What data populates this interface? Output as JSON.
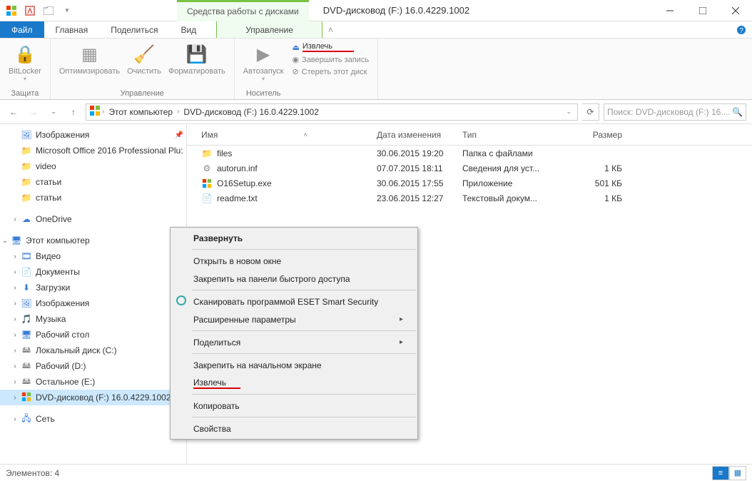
{
  "title": "DVD-дисковод (F:) 16.0.4229.1002",
  "contextual_tab_label": "Средства работы с дисками",
  "tabs": {
    "file": "Файл",
    "home": "Главная",
    "share": "Поделиться",
    "view": "Вид",
    "manage": "Управление"
  },
  "ribbon": {
    "group1_label": "Защита",
    "bitlocker": "BitLocker",
    "group2_label": "Управление",
    "optimize": "Оптимизировать",
    "cleanup": "Очистить",
    "format": "Форматировать",
    "group3_label": "Носитель",
    "autorun": "Автозапуск",
    "eject": "Извлечь",
    "finalize": "Завершить запись",
    "erase": "Стереть этот диск"
  },
  "breadcrumb": {
    "this_pc": "Этот компьютер",
    "dvd": "DVD-дисковод (F:) 16.0.4229.1002"
  },
  "search_placeholder": "Поиск: DVD-дисковод (F:) 16....",
  "sidebar": {
    "pictures": "Изображения",
    "office": "Microsoft Office 2016 Professional Plu:",
    "video": "video",
    "articles1": "статьи",
    "articles2": "статьи",
    "onedrive": "OneDrive",
    "this_pc": "Этот компьютер",
    "videos": "Видео",
    "documents": "Документы",
    "downloads": "Загрузки",
    "pictures2": "Изображения",
    "music": "Музыка",
    "desktop": "Рабочий стол",
    "local_c": "Локальный диск (C:)",
    "local_d": "Рабочий (D:)",
    "local_e": "Остальное (E:)",
    "dvd_f": "DVD-дисковод (F:) 16.0.4229.1002",
    "network": "Сеть"
  },
  "columns": {
    "name": "Имя",
    "date": "Дата изменения",
    "type": "Тип",
    "size": "Размер"
  },
  "files": [
    {
      "name": "files",
      "date": "30.06.2015 19:20",
      "type": "Папка с файлами",
      "size": "",
      "icon": "folder"
    },
    {
      "name": "autorun.inf",
      "date": "07.07.2015 18:11",
      "type": "Сведения для уст...",
      "size": "1 КБ",
      "icon": "inf"
    },
    {
      "name": "O16Setup.exe",
      "date": "30.06.2015 17:55",
      "type": "Приложение",
      "size": "501 КБ",
      "icon": "office"
    },
    {
      "name": "readme.txt",
      "date": "23.06.2015 12:27",
      "type": "Текстовый докум...",
      "size": "1 КБ",
      "icon": "txt"
    }
  ],
  "context_menu": {
    "expand": "Развернуть",
    "open_new_window": "Открыть в новом окне",
    "pin_quick": "Закрепить на панели быстрого доступа",
    "scan_eset": "Сканировать программой ESET Smart Security",
    "advanced": "Расширенные параметры",
    "share": "Поделиться",
    "pin_start": "Закрепить на начальном экране",
    "eject": "Извлечь",
    "copy": "Копировать",
    "properties": "Свойства"
  },
  "statusbar": {
    "items": "Элементов: 4"
  }
}
